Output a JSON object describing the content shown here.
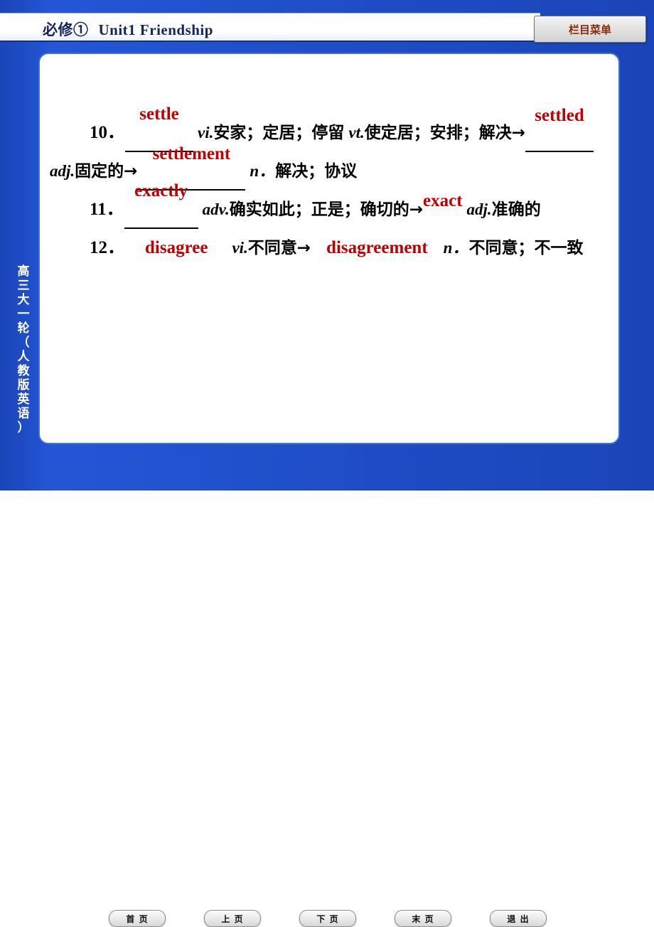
{
  "header": {
    "title_prefix": "必修①",
    "title_unit": "Unit1 Friendship",
    "menu_button": "栏目菜单"
  },
  "side_label": {
    "line1": "高三大一轮",
    "line2": "（人教版英语）"
  },
  "content": {
    "items": [
      {
        "number": "10．",
        "answer1": "settle",
        "pos1": "vi.",
        "cn1": "安家；定居；停留",
        "pos2": "vt.",
        "cn2": "使定居；安排；解决→",
        "answer2": "settled",
        "pos3": "adj.",
        "cn3": "固定的→",
        "answer3": "settlement",
        "pos4": "n．",
        "cn4": "解决；协议"
      },
      {
        "number": "11．",
        "answer1": "exactly",
        "pos1": "adv.",
        "cn1": "确实如此；正是；确切的→",
        "answer2": "exact",
        "pos2": "adj.",
        "cn2": "准确的"
      },
      {
        "number": "12．",
        "answer1": "disagree",
        "pos1": "vi.",
        "cn1": "不同意→",
        "answer2": "disagreement",
        "pos2": "n．",
        "cn2": "不同意；不一致"
      }
    ]
  },
  "nav": {
    "buttons": [
      {
        "label": "首 页",
        "name": "first-page"
      },
      {
        "label": "上 页",
        "name": "prev-page"
      },
      {
        "label": "下 页",
        "name": "next-page"
      },
      {
        "label": "末 页",
        "name": "last-page"
      },
      {
        "label": "退 出",
        "name": "exit"
      }
    ]
  },
  "colors": {
    "background": "#1B44B8",
    "answer_red": "#C00000",
    "title_blue": "#12245C",
    "panel_border": "#3F6FD8"
  }
}
